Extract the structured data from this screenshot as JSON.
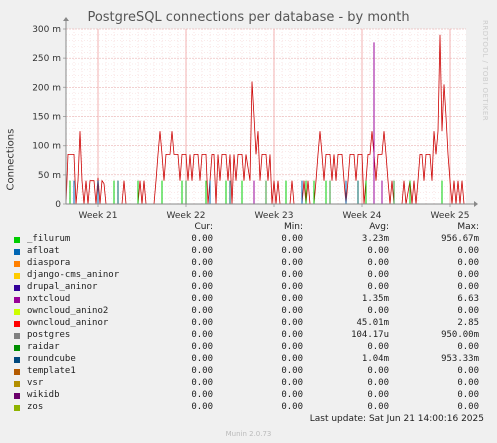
{
  "chart_data": {
    "type": "line",
    "title": "PostgreSQL connections per database - by month",
    "ylabel": "Connections",
    "watermark": "RRDTOOL / TOBI OETIKER",
    "ylim": [
      0,
      300
    ],
    "y_ticks": [
      0,
      50,
      100,
      150,
      200,
      250,
      300
    ],
    "y_tick_labels": [
      "0",
      "50 m",
      "100 m",
      "150 m",
      "200 m",
      "250 m",
      "300 m"
    ],
    "x_range": [
      0,
      100
    ],
    "x_ticks": [
      {
        "label": "Week 21",
        "x": 8
      },
      {
        "label": "Week 22",
        "x": 30
      },
      {
        "label": "Week 23",
        "x": 52
      },
      {
        "label": "Week 24",
        "x": 74
      },
      {
        "label": "Week 25",
        "x": 96
      }
    ],
    "grid": true,
    "series": [
      {
        "name": "owncloud_aninor",
        "color": "#cc0000",
        "style": "line",
        "points": [
          [
            0,
            0
          ],
          [
            0.5,
            85
          ],
          [
            2,
            85
          ],
          [
            2.5,
            0
          ],
          [
            3,
            40
          ],
          [
            3.5,
            125
          ],
          [
            4,
            40
          ],
          [
            4.5,
            0
          ],
          [
            5,
            40
          ],
          [
            5.5,
            0
          ],
          [
            6,
            40
          ],
          [
            7,
            40
          ],
          [
            7.5,
            0
          ],
          [
            8,
            45
          ],
          [
            8.5,
            0
          ],
          [
            9,
            40
          ],
          [
            9.5,
            35
          ],
          [
            10,
            0
          ],
          [
            14,
            0
          ],
          [
            14.5,
            40
          ],
          [
            15,
            0
          ],
          [
            18,
            0
          ],
          [
            18.5,
            40
          ],
          [
            19,
            0
          ],
          [
            19.5,
            40
          ],
          [
            20,
            0
          ],
          [
            22,
            0
          ],
          [
            22.5,
            40
          ],
          [
            23,
            85
          ],
          [
            23.5,
            125
          ],
          [
            24,
            85
          ],
          [
            24.5,
            40
          ],
          [
            25,
            85
          ],
          [
            26,
            85
          ],
          [
            26.5,
            125
          ],
          [
            27,
            85
          ],
          [
            28,
            85
          ],
          [
            28.5,
            40
          ],
          [
            29,
            85
          ],
          [
            30,
            85
          ],
          [
            30.5,
            40
          ],
          [
            31,
            85
          ],
          [
            31.5,
            40
          ],
          [
            32,
            85
          ],
          [
            33,
            85
          ],
          [
            33.5,
            40
          ],
          [
            34,
            85
          ],
          [
            35,
            85
          ],
          [
            35.5,
            0
          ],
          [
            36,
            40
          ],
          [
            36.5,
            85
          ],
          [
            37,
            85
          ],
          [
            37.5,
            0
          ],
          [
            38,
            85
          ],
          [
            38.5,
            40
          ],
          [
            39,
            85
          ],
          [
            40,
            85
          ],
          [
            40.5,
            40
          ],
          [
            41,
            85
          ],
          [
            41.5,
            0
          ],
          [
            42,
            85
          ],
          [
            42.5,
            40
          ],
          [
            43,
            85
          ],
          [
            44,
            85
          ],
          [
            44.5,
            40
          ],
          [
            45,
            85
          ],
          [
            46,
            40
          ],
          [
            46.5,
            210
          ],
          [
            47,
            150
          ],
          [
            47.5,
            85
          ],
          [
            48,
            125
          ],
          [
            48.5,
            40
          ],
          [
            49,
            85
          ],
          [
            50,
            85
          ],
          [
            50.5,
            40
          ],
          [
            51,
            85
          ],
          [
            51.5,
            0
          ],
          [
            52,
            40
          ],
          [
            52.5,
            0
          ],
          [
            53,
            40
          ],
          [
            53.5,
            0
          ],
          [
            56,
            0
          ],
          [
            56.5,
            40
          ],
          [
            57,
            0
          ],
          [
            59,
            0
          ],
          [
            59.5,
            40
          ],
          [
            60,
            0
          ],
          [
            60.5,
            40
          ],
          [
            61,
            0
          ],
          [
            62,
            0
          ],
          [
            62.5,
            40
          ],
          [
            63,
            85
          ],
          [
            63.5,
            125
          ],
          [
            64,
            85
          ],
          [
            64.5,
            40
          ],
          [
            65,
            85
          ],
          [
            66,
            85
          ],
          [
            66.5,
            40
          ],
          [
            67,
            85
          ],
          [
            67.5,
            40
          ],
          [
            68,
            85
          ],
          [
            69,
            85
          ],
          [
            69.5,
            40
          ],
          [
            70,
            0
          ],
          [
            70.5,
            40
          ],
          [
            71,
            85
          ],
          [
            72,
            85
          ],
          [
            72.5,
            40
          ],
          [
            73,
            85
          ],
          [
            74,
            85
          ],
          [
            74.5,
            0
          ],
          [
            75,
            40
          ],
          [
            75.5,
            85
          ],
          [
            76,
            85
          ],
          [
            76.5,
            125
          ],
          [
            77,
            85
          ],
          [
            77.5,
            40
          ],
          [
            78,
            85
          ],
          [
            79,
            85
          ],
          [
            79.5,
            125
          ],
          [
            80,
            85
          ],
          [
            80.5,
            40
          ],
          [
            81,
            0
          ],
          [
            81.5,
            40
          ],
          [
            82,
            0
          ],
          [
            84,
            0
          ],
          [
            84.5,
            40
          ],
          [
            85,
            0
          ],
          [
            86,
            40
          ],
          [
            86.5,
            0
          ],
          [
            87,
            40
          ],
          [
            87.5,
            0
          ],
          [
            88,
            40
          ],
          [
            88.5,
            85
          ],
          [
            89,
            85
          ],
          [
            89.5,
            40
          ],
          [
            90,
            85
          ],
          [
            91,
            85
          ],
          [
            91.5,
            40
          ],
          [
            92,
            125
          ],
          [
            92.5,
            85
          ],
          [
            93,
            125
          ],
          [
            93.5,
            290
          ],
          [
            94,
            125
          ],
          [
            94.5,
            205
          ],
          [
            95,
            150
          ],
          [
            95.5,
            85
          ],
          [
            96,
            40
          ],
          [
            96.5,
            0
          ],
          [
            97,
            40
          ],
          [
            97.5,
            0
          ],
          [
            98,
            40
          ],
          [
            98.5,
            0
          ],
          [
            99,
            40
          ],
          [
            99.5,
            0
          ]
        ]
      },
      {
        "name": "_filurum",
        "color": "#00cc00",
        "style": "spikes",
        "points": [
          [
            1,
            40
          ],
          [
            12,
            40
          ],
          [
            18,
            40
          ],
          [
            24,
            40
          ],
          [
            29,
            40
          ],
          [
            35,
            40
          ],
          [
            40,
            40
          ],
          [
            44,
            40
          ],
          [
            55,
            40
          ],
          [
            60,
            40
          ],
          [
            62,
            40
          ],
          [
            65,
            40
          ],
          [
            75,
            40
          ],
          [
            77,
            40
          ],
          [
            86,
            40
          ],
          [
            94,
            40
          ]
        ]
      },
      {
        "name": "afloat",
        "color": "#0066b3",
        "style": "spikes",
        "points": [
          [
            2,
            40
          ],
          [
            8,
            40
          ],
          [
            36,
            40
          ],
          [
            59,
            40
          ],
          [
            70,
            40
          ]
        ]
      },
      {
        "name": "nxtcloud",
        "color": "#990099",
        "style": "spikes",
        "points": [
          [
            47,
            40
          ],
          [
            77,
            277
          ],
          [
            79,
            40
          ]
        ]
      },
      {
        "name": "roundcube",
        "color": "#006666",
        "style": "spikes",
        "points": [
          [
            13,
            40
          ],
          [
            41,
            40
          ],
          [
            73,
            40
          ]
        ]
      },
      {
        "name": "postgres",
        "color": "#339933",
        "style": "spikes",
        "points": [
          [
            30,
            40
          ],
          [
            50,
            40
          ],
          [
            66,
            40
          ],
          [
            82,
            40
          ]
        ]
      }
    ]
  },
  "legend": {
    "headers": {
      "cur": "Cur:",
      "min": "Min:",
      "avg": "Avg:",
      "max": "Max:"
    },
    "rows": [
      {
        "name": "_filurum",
        "color": "#00cc00",
        "cur": "0.00",
        "min": "0.00",
        "avg": "3.23m",
        "max": "956.67m"
      },
      {
        "name": "afloat",
        "color": "#0066b3",
        "cur": "0.00",
        "min": "0.00",
        "avg": "0.00",
        "max": "0.00"
      },
      {
        "name": "diaspora",
        "color": "#ff8000",
        "cur": "0.00",
        "min": "0.00",
        "avg": "0.00",
        "max": "0.00"
      },
      {
        "name": "django-cms_aninor",
        "color": "#ffcc00",
        "cur": "0.00",
        "min": "0.00",
        "avg": "0.00",
        "max": "0.00"
      },
      {
        "name": "drupal_aninor",
        "color": "#330099",
        "cur": "0.00",
        "min": "0.00",
        "avg": "0.00",
        "max": "0.00"
      },
      {
        "name": "nxtcloud",
        "color": "#990099",
        "cur": "0.00",
        "min": "0.00",
        "avg": "1.35m",
        "max": "6.63"
      },
      {
        "name": "owncloud_anino2",
        "color": "#ccff00",
        "cur": "0.00",
        "min": "0.00",
        "avg": "0.00",
        "max": "0.00"
      },
      {
        "name": "owncloud_aninor",
        "color": "#ff0000",
        "cur": "0.00",
        "min": "0.00",
        "avg": "45.01m",
        "max": "2.85"
      },
      {
        "name": "postgres",
        "color": "#808080",
        "cur": "0.00",
        "min": "0.00",
        "avg": "104.17u",
        "max": "950.00m"
      },
      {
        "name": "raidar",
        "color": "#008f00",
        "cur": "0.00",
        "min": "0.00",
        "avg": "0.00",
        "max": "0.00"
      },
      {
        "name": "roundcube",
        "color": "#00487d",
        "cur": "0.00",
        "min": "0.00",
        "avg": "1.04m",
        "max": "953.33m"
      },
      {
        "name": "template1",
        "color": "#b35a00",
        "cur": "0.00",
        "min": "0.00",
        "avg": "0.00",
        "max": "0.00"
      },
      {
        "name": "vsr",
        "color": "#b38f00",
        "cur": "0.00",
        "min": "0.00",
        "avg": "0.00",
        "max": "0.00"
      },
      {
        "name": "wikidb",
        "color": "#6b006b",
        "cur": "0.00",
        "min": "0.00",
        "avg": "0.00",
        "max": "0.00"
      },
      {
        "name": "zos",
        "color": "#8fb300",
        "cur": "0.00",
        "min": "0.00",
        "avg": "0.00",
        "max": "0.00"
      }
    ]
  },
  "footer": {
    "last_update": "Last update: Sat Jun 21 14:00:16 2025",
    "version": "Munin 2.0.73"
  }
}
